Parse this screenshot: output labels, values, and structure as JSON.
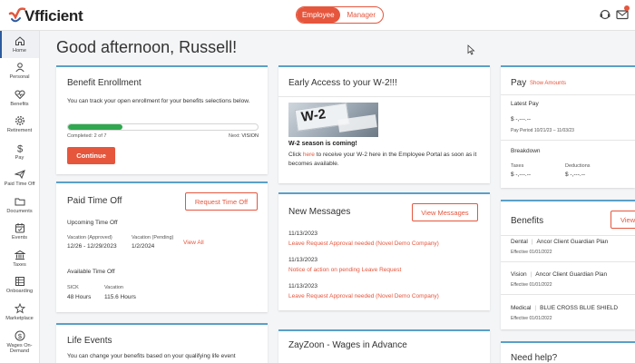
{
  "app": {
    "logo_text": "Vfficient",
    "roles": [
      "Employee",
      "Manager"
    ],
    "accent": "#e5563d",
    "card_accent": "#5aa0c8"
  },
  "topbar_icons": [
    "headset-icon",
    "mail-icon"
  ],
  "sidebar": {
    "items": [
      {
        "label": "Home",
        "icon": "home-icon"
      },
      {
        "label": "Personal",
        "icon": "person-icon"
      },
      {
        "label": "Benefits",
        "icon": "heart-pulse-icon"
      },
      {
        "label": "Retirement",
        "icon": "gear-icon"
      },
      {
        "label": "Pay",
        "icon": "dollar-icon"
      },
      {
        "label": "Paid Time Off",
        "icon": "plane-icon"
      },
      {
        "label": "Documents",
        "icon": "folder-icon"
      },
      {
        "label": "Events",
        "icon": "calendar-icon"
      },
      {
        "label": "Taxes",
        "icon": "bank-icon"
      },
      {
        "label": "Onboarding",
        "icon": "clipboard-icon"
      },
      {
        "label": "Marketplace",
        "icon": "star-icon"
      },
      {
        "label": "Wages On-Demand",
        "icon": "dollar-circle-icon"
      }
    ]
  },
  "greeting": "Good afternoon, Russell!",
  "benefit_enrollment": {
    "title": "Benefit Enrollment",
    "description": "You can track your open enrollment for your benefits selections below.",
    "progress": 0.2857,
    "completed_label": "Completed:",
    "completed_value": "2 of 7",
    "next_label": "Next:",
    "next_value": "VISION",
    "continue_label": "Continue"
  },
  "paid_time_off": {
    "title": "Paid Time Off",
    "request_label": "Request Time Off",
    "upcoming_title": "Upcoming Time Off",
    "upcoming": [
      {
        "type": "Vacation (Approved)",
        "dates": "12/26 - 12/29/2023"
      },
      {
        "type": "Vacation (Pending)",
        "dates": "1/2/2024"
      }
    ],
    "view_all": "View All",
    "available_title": "Available Time Off",
    "available": [
      {
        "type": "SICK",
        "hours": "48 Hours"
      },
      {
        "type": "Vacation",
        "hours": "115.6 Hours"
      }
    ]
  },
  "life_events": {
    "title": "Life Events",
    "description": "You can change your benefits based on your qualifying life event"
  },
  "w2": {
    "title": "Early Access to your W-2!!!",
    "image_text": "W-2",
    "headline": "W-2 season is coming!",
    "body_prefix": "Click ",
    "body_link": "here",
    "body_suffix": " to receive your W-2 here in the Employee Portal as soon as it becomes available."
  },
  "messages": {
    "title": "New Messages",
    "view_label": "View Messages",
    "items": [
      {
        "date": "11/13/2023",
        "text": "Leave Request Approval needed (Novel Demo Company)"
      },
      {
        "date": "11/13/2023",
        "text": "Notice of action on pending Leave Request"
      },
      {
        "date": "11/13/2023",
        "text": "Leave Request Approval needed (Novel Demo Company)"
      }
    ]
  },
  "zayzoon": {
    "title": "ZayZoon - Wages in Advance"
  },
  "pay": {
    "title": "Pay",
    "show_amounts": "Show Amounts",
    "latest_pay_label": "Latest Pay",
    "latest_pay_value": "$ -,---.--",
    "pay_period": "Pay Period 10/21/23 – 11/03/23",
    "breakdown_label": "Breakdown",
    "taxes_label": "Taxes",
    "taxes_value": "$ -,---.--",
    "deductions_label": "Deductions",
    "deductions_value": "$ -,---.--"
  },
  "benefits": {
    "title": "Benefits",
    "view_label": "View",
    "plans": [
      {
        "type": "Dental",
        "plan": "Ancor Client Guardian Plan",
        "effective": "Effective 01/01/2022"
      },
      {
        "type": "Vision",
        "plan": "Ancor Client Guardian Plan",
        "effective": "Effective 01/01/2022"
      },
      {
        "type": "Medical",
        "plan": "BLUE CROSS BLUE SHIELD",
        "effective": "Effective 01/01/2022"
      }
    ]
  },
  "help": {
    "title": "Need help?"
  }
}
